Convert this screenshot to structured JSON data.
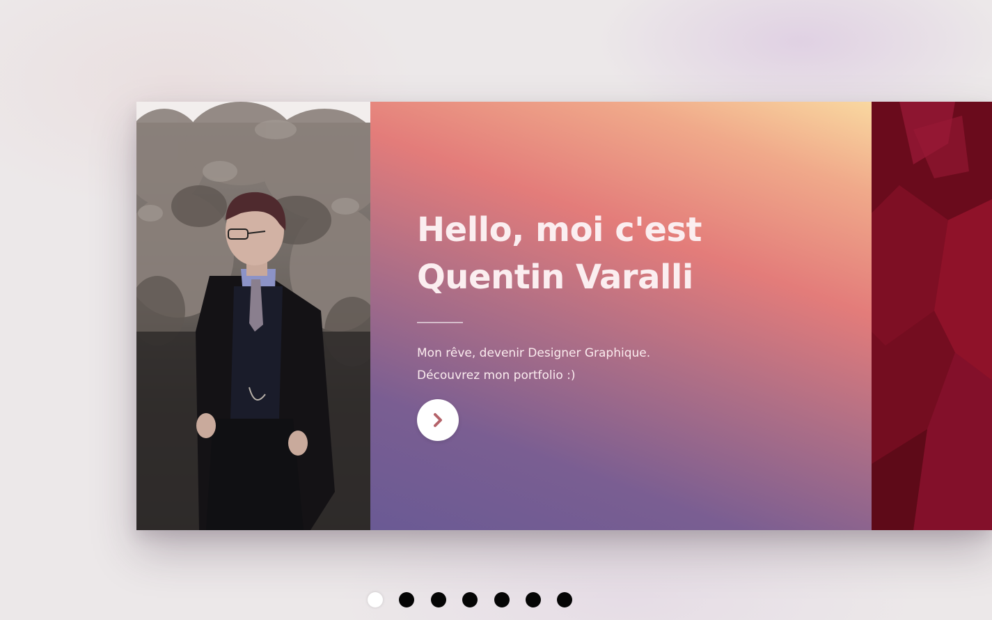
{
  "hero": {
    "title_line1": "Hello, moi c'est",
    "title_line2": "Quentin Varalli",
    "text_line1": "Mon rêve, devenir Designer Graphique.",
    "text_line2": "Découvrez mon portfolio :)",
    "next_icon": "chevron-right-icon"
  },
  "pagination": {
    "count": 7,
    "active_index": 0
  },
  "colors": {
    "gradient_purple": "#6a5a94",
    "gradient_coral": "#e37c7a",
    "gradient_peach": "#f9d8a0",
    "next_slide_red": "#8a1028",
    "chevron": "#b5636a",
    "dot_inactive": "#050505",
    "dot_active": "#ffffff"
  }
}
